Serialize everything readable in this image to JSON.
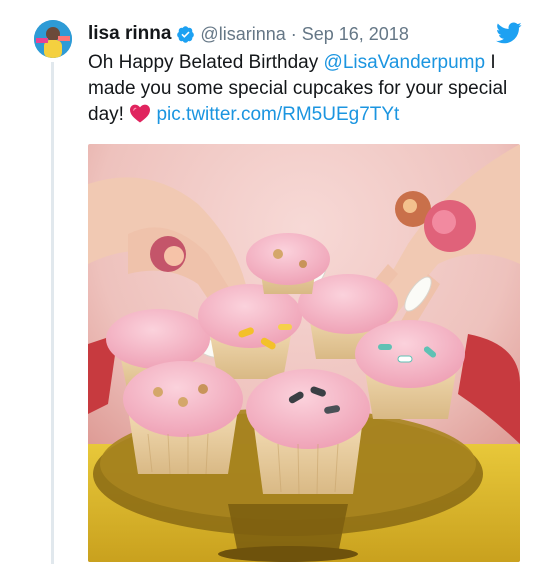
{
  "tweet": {
    "display_name": "lisa rinna",
    "handle": "@lisarinna",
    "separator": "·",
    "date": "Sep 16, 2018",
    "text_part1": "Oh Happy Belated Birthday ",
    "mention": "@LisaVanderpump",
    "text_part2": " I made you some special cupcakes for your special day! ",
    "heart_emoji": "heart-emoji",
    "media_link": "pic.twitter.com/RM5UEg7TYt"
  },
  "icons": {
    "verified": "verified-badge-icon",
    "bird": "twitter-bird-icon"
  },
  "colors": {
    "link": "#1b95e0",
    "verified": "#1da1f2",
    "heart": "#e0245e",
    "muted": "#657786"
  }
}
